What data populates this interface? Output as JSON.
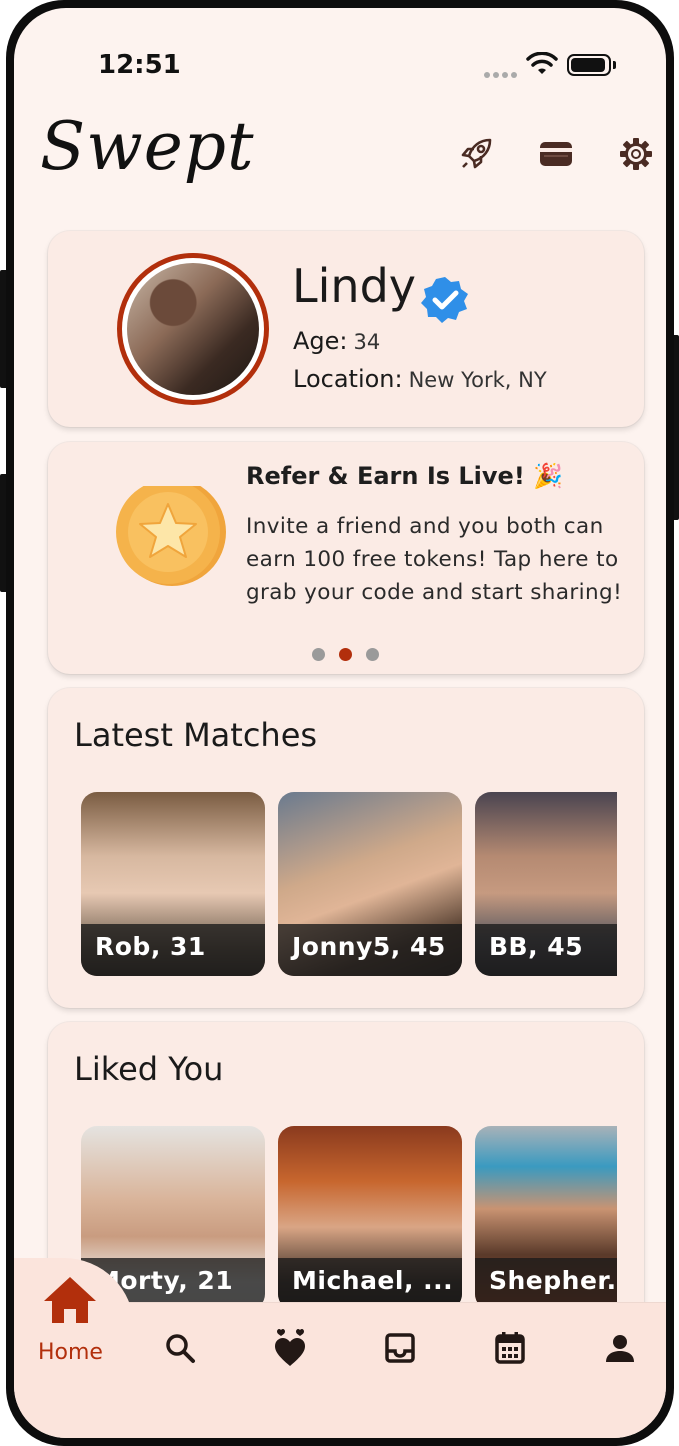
{
  "status_bar": {
    "time": "12:51"
  },
  "app": {
    "logo": "Swept"
  },
  "header_icons": [
    "rocket-icon",
    "wallet-icon",
    "gear-icon"
  ],
  "profile": {
    "name": "Lindy",
    "age_label": "Age:",
    "age_value": "34",
    "location_label": "Location:",
    "location_value": "New York, NY"
  },
  "promo": {
    "title": "Refer & Earn Is Live! 🎉",
    "body": "Invite a friend and you both can earn 100 free tokens! Tap here to grab your code and start sharing!",
    "page_count": 3,
    "active_page": 2
  },
  "latest_matches": {
    "title": "Latest Matches",
    "items": [
      {
        "label": "Rob, 31"
      },
      {
        "label": "Jonny5, 45"
      },
      {
        "label": "BB, 45"
      }
    ]
  },
  "liked_you": {
    "title": "Liked You",
    "items": [
      {
        "label": "Morty, 21"
      },
      {
        "label": "Michael, ..."
      },
      {
        "label": "Shepher..."
      }
    ]
  },
  "bottom_nav": {
    "home_label": "Home",
    "items": [
      "home-icon",
      "search-icon",
      "hearts-icon",
      "inbox-icon",
      "calendar-icon",
      "person-icon"
    ]
  },
  "colors": {
    "accent": "#b22f0c",
    "background": "#fdf3ef",
    "card": "#fbebe5",
    "verified": "#2f8fe8",
    "coin": "#f5b34b"
  }
}
